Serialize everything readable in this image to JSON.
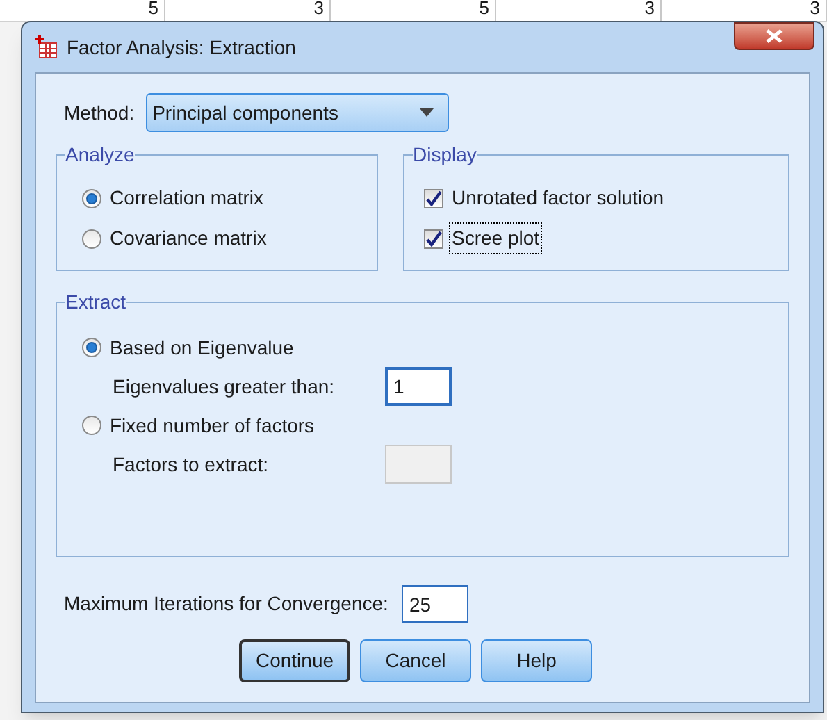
{
  "background_cells": [
    "5",
    "3",
    "5",
    "3",
    "3"
  ],
  "window": {
    "title": "Factor Analysis: Extraction"
  },
  "method": {
    "label": "Method:",
    "value": "Principal components"
  },
  "analyze": {
    "title": "Analyze",
    "options": [
      {
        "label": "Correlation matrix",
        "selected": true
      },
      {
        "label": "Covariance matrix",
        "selected": false
      }
    ]
  },
  "display": {
    "title": "Display",
    "options": [
      {
        "label": "Unrotated factor solution",
        "checked": true,
        "focused": false
      },
      {
        "label": "Scree plot",
        "checked": true,
        "focused": true
      }
    ]
  },
  "extract": {
    "title": "Extract",
    "options": [
      {
        "label": "Based on Eigenvalue",
        "selected": true,
        "field_label": "Eigenvalues greater than:",
        "value": "1",
        "disabled": false
      },
      {
        "label": "Fixed number of factors",
        "selected": false,
        "field_label": "Factors to extract:",
        "disabled": true
      }
    ]
  },
  "iterations": {
    "label": "Maximum Iterations for Convergence:",
    "value": "25"
  },
  "buttons": [
    {
      "label": "Continue",
      "default": true
    },
    {
      "label": "Cancel",
      "default": false
    },
    {
      "label": "Help",
      "default": false
    }
  ]
}
